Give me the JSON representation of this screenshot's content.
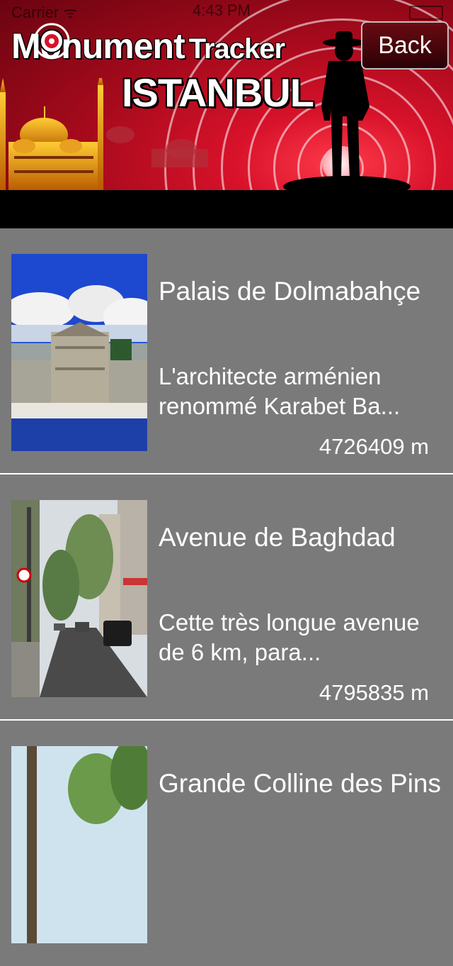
{
  "status_bar": {
    "carrier": "Carrier ᯤ",
    "time": "4:43 PM"
  },
  "header": {
    "app_title_part1": "Monument",
    "app_title_part2": "Tracker",
    "city": "ISTANBUL",
    "back_label": "Back",
    "accent_color": "#d8122a"
  },
  "monuments": [
    {
      "name": "Palais de Dolmabahçe",
      "description": "L'architecte arménien renommé Karabet Ba...",
      "distance": "4726409 m"
    },
    {
      "name": "Avenue de Baghdad",
      "description": "Cette très longue avenue de 6 km, para...",
      "distance": "4795835 m"
    },
    {
      "name": "Grande Colline des Pins",
      "description": "",
      "distance": ""
    }
  ]
}
